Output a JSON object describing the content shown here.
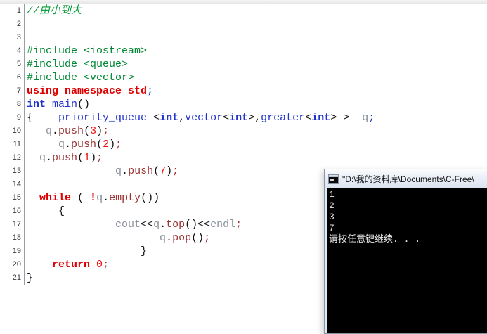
{
  "colors": {
    "comment_green": "#009933",
    "preprocessor_green": "#008833",
    "keyword_red": "#e00000",
    "type_blue": "#2233cc",
    "identifier_gray": "#8a9199",
    "member_maroon": "#9b3333",
    "number_red": "#ee1111",
    "console_bg": "#000000",
    "console_text": "#ececec"
  },
  "editor": {
    "lines": [
      {
        "n": "1",
        "seg": [
          [
            "com",
            "//由小到大"
          ]
        ]
      },
      {
        "n": "2",
        "seg": []
      },
      {
        "n": "3",
        "seg": []
      },
      {
        "n": "4",
        "seg": [
          [
            "pre",
            "#include <iostream>"
          ]
        ]
      },
      {
        "n": "5",
        "seg": [
          [
            "pre",
            "#include <queue>"
          ]
        ]
      },
      {
        "n": "6",
        "seg": [
          [
            "pre",
            "#include <vector>"
          ]
        ]
      },
      {
        "n": "7",
        "seg": [
          [
            "kw",
            "using namespace std"
          ],
          [
            "semi",
            ";"
          ]
        ]
      },
      {
        "n": "8",
        "seg": [
          [
            "typeb",
            "int"
          ],
          [
            "p",
            " "
          ],
          [
            "type",
            "main"
          ],
          [
            "p",
            "()"
          ]
        ]
      },
      {
        "n": "9",
        "seg": [
          [
            "p",
            "{    "
          ],
          [
            "type",
            "priority_queue"
          ],
          [
            "p",
            " <"
          ],
          [
            "typeb",
            "int"
          ],
          [
            "p",
            ","
          ],
          [
            "type",
            "vector"
          ],
          [
            "p",
            "<"
          ],
          [
            "typeb",
            "int"
          ],
          [
            "p",
            ">,"
          ],
          [
            "type",
            "greater"
          ],
          [
            "p",
            "<"
          ],
          [
            "typeb",
            "int"
          ],
          [
            "p",
            "> >  "
          ],
          [
            "id",
            "q"
          ],
          [
            "semi",
            ";"
          ]
        ]
      },
      {
        "n": "10",
        "seg": [
          [
            "p",
            "   "
          ],
          [
            "id",
            "q"
          ],
          [
            "p",
            "."
          ],
          [
            "mem",
            "push"
          ],
          [
            "p",
            "("
          ],
          [
            "num",
            "3"
          ],
          [
            "p",
            ")"
          ],
          [
            "mem",
            ";"
          ]
        ]
      },
      {
        "n": "11",
        "seg": [
          [
            "p",
            "     "
          ],
          [
            "id",
            "q"
          ],
          [
            "p",
            "."
          ],
          [
            "mem",
            "push"
          ],
          [
            "p",
            "("
          ],
          [
            "num",
            "2"
          ],
          [
            "p",
            ")"
          ],
          [
            "mem",
            ";"
          ]
        ]
      },
      {
        "n": "12",
        "seg": [
          [
            "p",
            "  "
          ],
          [
            "id",
            "q"
          ],
          [
            "p",
            "."
          ],
          [
            "mem",
            "push"
          ],
          [
            "p",
            "("
          ],
          [
            "num",
            "1"
          ],
          [
            "p",
            ")"
          ],
          [
            "mem",
            ";"
          ]
        ]
      },
      {
        "n": "13",
        "seg": [
          [
            "p",
            "              "
          ],
          [
            "id",
            "q"
          ],
          [
            "p",
            "."
          ],
          [
            "mem",
            "push"
          ],
          [
            "p",
            "("
          ],
          [
            "num",
            "7"
          ],
          [
            "p",
            ")"
          ],
          [
            "mem",
            ";"
          ]
        ]
      },
      {
        "n": "14",
        "seg": []
      },
      {
        "n": "15",
        "seg": [
          [
            "p",
            "  "
          ],
          [
            "kw",
            "while"
          ],
          [
            "p",
            " ( "
          ],
          [
            "kw",
            "!"
          ],
          [
            "id",
            "q"
          ],
          [
            "p",
            "."
          ],
          [
            "mem",
            "empty"
          ],
          [
            "p",
            "())"
          ]
        ]
      },
      {
        "n": "16",
        "seg": [
          [
            "p",
            "     {"
          ]
        ]
      },
      {
        "n": "17",
        "seg": [
          [
            "p",
            "              "
          ],
          [
            "id",
            "cout"
          ],
          [
            "p",
            "<<"
          ],
          [
            "id",
            "q"
          ],
          [
            "p",
            "."
          ],
          [
            "mem",
            "top"
          ],
          [
            "p",
            "()"
          ],
          [
            "p",
            "<<"
          ],
          [
            "id",
            "endl"
          ],
          [
            "mem",
            ";"
          ]
        ]
      },
      {
        "n": "18",
        "seg": [
          [
            "p",
            "                     "
          ],
          [
            "id",
            "q"
          ],
          [
            "p",
            "."
          ],
          [
            "mem",
            "pop"
          ],
          [
            "p",
            "()"
          ],
          [
            "mem",
            ";"
          ]
        ]
      },
      {
        "n": "19",
        "seg": [
          [
            "p",
            "                  }"
          ]
        ]
      },
      {
        "n": "20",
        "seg": [
          [
            "p",
            "    "
          ],
          [
            "kw",
            "return"
          ],
          [
            "p",
            " "
          ],
          [
            "num",
            "0"
          ],
          [
            "mem",
            ";"
          ]
        ]
      },
      {
        "n": "21",
        "seg": [
          [
            "p",
            "}"
          ]
        ]
      }
    ]
  },
  "console": {
    "title": "\"D:\\我的资料库\\Documents\\C-Free\\",
    "output": [
      "1",
      "2",
      "3",
      "7",
      "请按任意键继续. . ."
    ]
  }
}
